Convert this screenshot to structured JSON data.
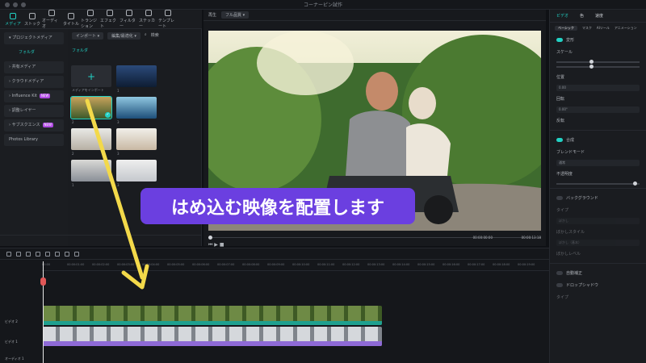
{
  "app": {
    "title": "コーナーピン試作"
  },
  "toolbar": {
    "items": [
      "メディア",
      "ストック",
      "オーディオ",
      "タイトル",
      "トランジション",
      "エフェクト",
      "フィルター",
      "ステッカー",
      "テンプレート"
    ]
  },
  "sidebar": {
    "items": [
      {
        "label": "プロジェクトメディア",
        "active": false
      },
      {
        "label": "フォルダ",
        "active": true
      },
      {
        "label": "共有メディア",
        "active": false
      },
      {
        "label": "クラウドメディア",
        "active": false
      },
      {
        "label": "Influence Kit",
        "badge": "NEW"
      },
      {
        "label": "調整レイヤー",
        "active": false
      },
      {
        "label": "サブスクエンス",
        "badge": "NEW"
      },
      {
        "label": "Photos Library",
        "active": false
      }
    ]
  },
  "media": {
    "import_label": "インポート",
    "sort_label": "編集/最適化",
    "search_placeholder": "検索",
    "folder_label": "フォルダ",
    "import_tile": "メディアをインポート",
    "tiles": [
      "1",
      "2",
      "3",
      "2",
      "3",
      "1",
      "3",
      "2"
    ]
  },
  "preview": {
    "tab1": "再生",
    "tab2": "フル品質",
    "time_current": "00:00:00:00",
    "time_total": "00:00:13:18"
  },
  "right": {
    "tabs": [
      "ビデオ",
      "色",
      "速度"
    ],
    "subtabs": [
      "ベーシック",
      "マスク",
      "AIツール",
      "アニメーション"
    ],
    "transform": "変形",
    "scale": "スケール",
    "x_label": "X",
    "y_label": "Y",
    "position": "位置",
    "pos_x": "0.00",
    "pos_y": "0.00",
    "unit": "px",
    "rotation": "回転",
    "rotation_val": "0.00°",
    "flip": "反転",
    "composite": "合成",
    "blend": "ブレンドモード",
    "blend_val": "通常",
    "opacity": "不透明度",
    "background": "バックグラウンド",
    "type": "タイプ",
    "type_val": "ぼかし",
    "blur_style": "ぼかしスタイル",
    "blur_style_val": "ぼかし（基本）",
    "blur_level": "ぼかしレベル",
    "auto_enhance": "自動補正",
    "shadow": "ドロップシャドウ",
    "type2": "タイプ"
  },
  "timeline": {
    "ticks": [
      "00:00",
      "00:00:01:00",
      "00:00:02:00",
      "00:00:03:00",
      "00:00:04:00",
      "00:00:05:00",
      "00:00:06:00",
      "00:00:07:00",
      "00:00:08:00",
      "00:00:09:00",
      "00:00:10:00",
      "00:00:11:00",
      "00:00:12:00",
      "00:00:13:00",
      "00:00:14:00",
      "00:00:15:00",
      "00:00:16:00",
      "00:00:17:00",
      "00:00:18:00",
      "00:00:19:00"
    ],
    "track2": "ビデオ 2",
    "track1": "ビデオ 1",
    "audio": "オーディオ 1"
  },
  "annotation": {
    "text": "はめ込む映像を配置します"
  },
  "colors": {
    "accent": "#22d1c4",
    "callout": "#6b3fe0",
    "arrow": "#f3d94a",
    "clip_teal": "#1fa08f",
    "clip_purple": "#8e6ad6"
  }
}
